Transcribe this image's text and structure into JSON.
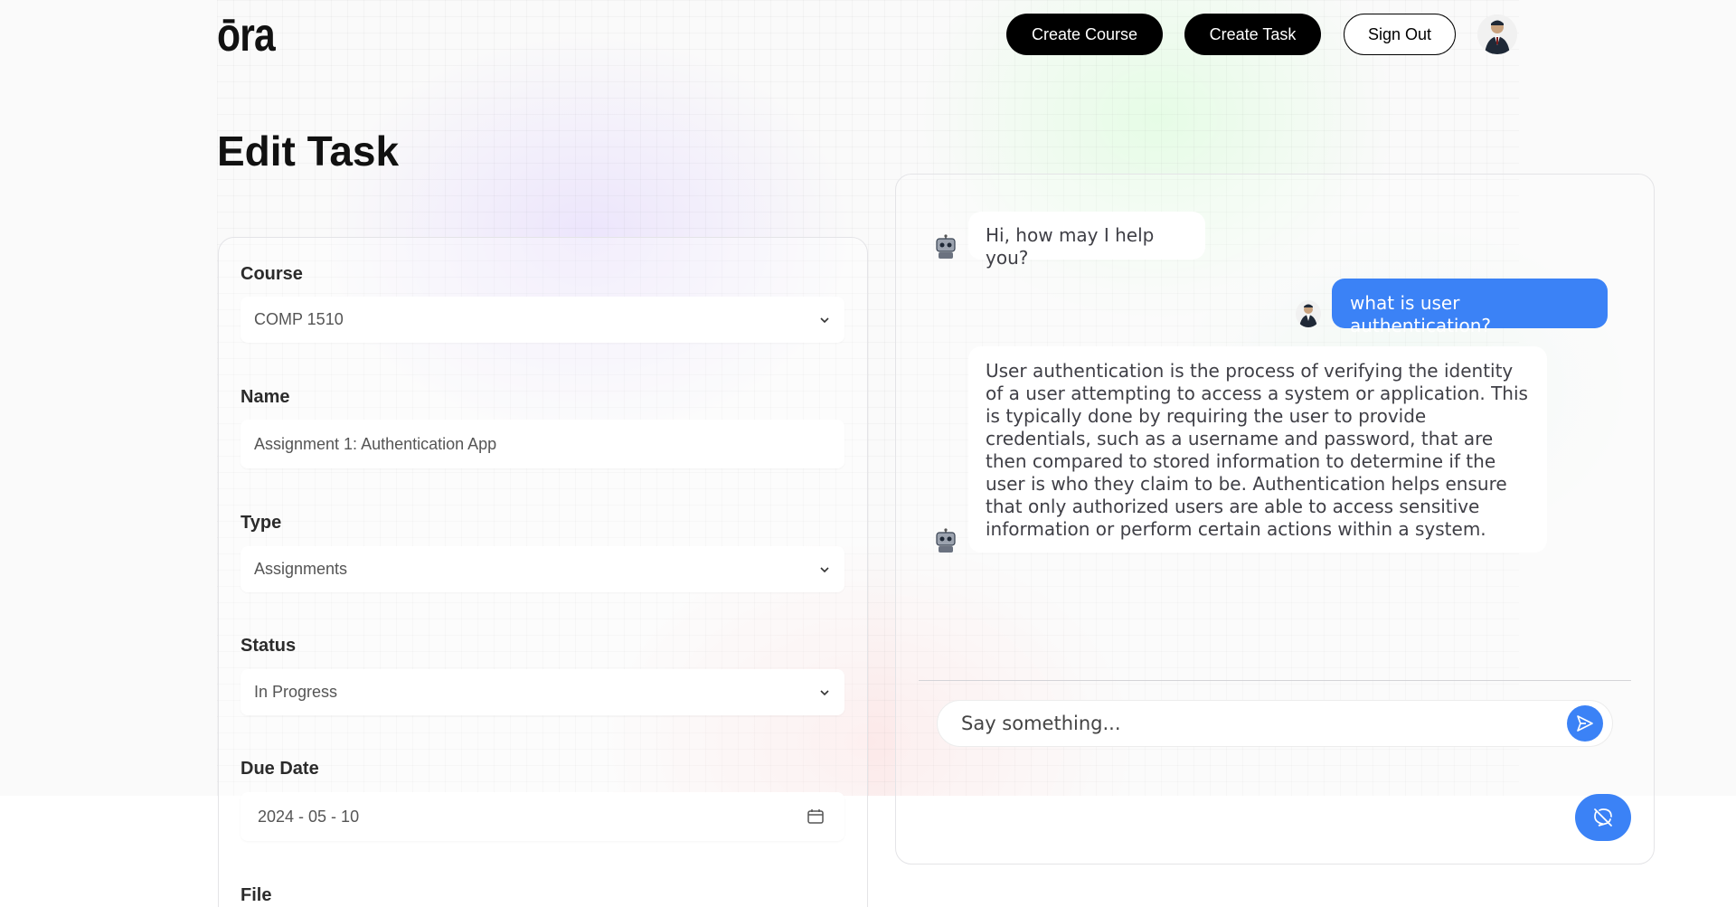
{
  "header": {
    "logo": "ōra",
    "create_course": "Create Course",
    "create_task": "Create Task",
    "sign_out": "Sign Out"
  },
  "page": {
    "title": "Edit Task"
  },
  "form": {
    "course": {
      "label": "Course",
      "value": "COMP 1510"
    },
    "name": {
      "label": "Name",
      "value": "Assignment 1: Authentication App"
    },
    "type": {
      "label": "Type",
      "value": "Assignments"
    },
    "status": {
      "label": "Status",
      "value": "In Progress"
    },
    "due_date": {
      "label": "Due Date",
      "value": "2024 - 05 - 10"
    },
    "file": {
      "label": "File"
    }
  },
  "chat": {
    "messages": [
      {
        "role": "bot",
        "text": "Hi, how may I help you?"
      },
      {
        "role": "user",
        "text": "what is user authentication?"
      },
      {
        "role": "bot",
        "text": "User authentication is the process of verifying the identity of a user attempting to access a system or application. This is typically done by requiring the user to provide credentials, such as a username and password, that are then compared to stored information to determine if the user is who they claim to be. Authentication helps ensure that only authorized users are able to access sensitive information or perform certain actions within a system."
      }
    ],
    "input_placeholder": "Say something..."
  },
  "colors": {
    "accent": "#3b82f6",
    "button_dark": "#000000",
    "border": "#e4e4e7"
  },
  "icons": [
    "chevron-down-icon",
    "calendar-icon",
    "robot-icon",
    "send-icon",
    "chat-off-icon",
    "user-avatar"
  ]
}
